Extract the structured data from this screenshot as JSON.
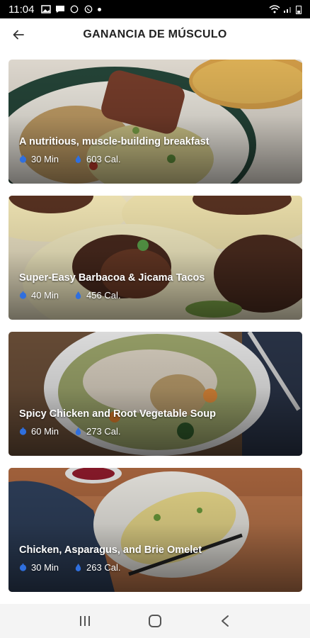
{
  "status_bar": {
    "time": "11:04"
  },
  "header": {
    "title": "GANANCIA DE MÚSCULO"
  },
  "colors": {
    "accent": "#2f6fde",
    "text_dark": "#222222"
  },
  "recipes": [
    {
      "title": "A nutritious, muscle-building breakfast",
      "time": "30 Min",
      "calories": "603 Cal."
    },
    {
      "title": "Super-Easy Barbacoa & Jicama Tacos",
      "time": "40 Min",
      "calories": "456 Cal."
    },
    {
      "title": "Spicy Chicken and Root Vegetable Soup",
      "time": "60 Min",
      "calories": "273 Cal."
    },
    {
      "title": "Chicken, Asparagus, and Brie Omelet",
      "time": "30 Min",
      "calories": "263 Cal."
    }
  ]
}
